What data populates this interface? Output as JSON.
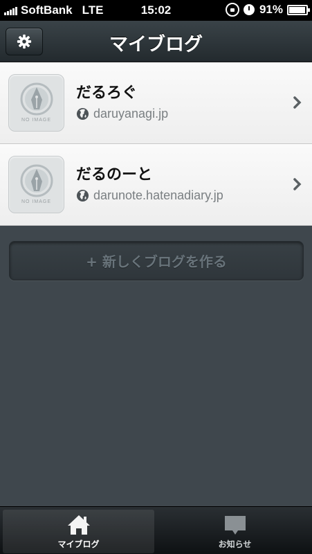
{
  "status_bar": {
    "carrier": "SoftBank",
    "network": "LTE",
    "time": "15:02",
    "battery": "91%"
  },
  "navbar": {
    "title": "マイブログ",
    "settings_icon": "gear-icon"
  },
  "blogs": [
    {
      "name": "だるろぐ",
      "url": "daruyanagi.jp",
      "thumbnail_label": "NO IMAGE"
    },
    {
      "name": "だるのーと",
      "url": "darunote.hatenadiary.jp",
      "thumbnail_label": "NO IMAGE"
    }
  ],
  "new_blog_button": {
    "label": "+ 新しくブログを作る"
  },
  "tabbar": {
    "tabs": [
      {
        "label": "マイブログ",
        "icon": "home-icon",
        "active": true
      },
      {
        "label": "お知らせ",
        "icon": "speech-bubble-icon",
        "active": false
      }
    ]
  },
  "colors": {
    "background": "#3f474d",
    "navbar": "#2c3438",
    "list_background": "#f2f2f2",
    "url_text": "#7a7f82"
  }
}
